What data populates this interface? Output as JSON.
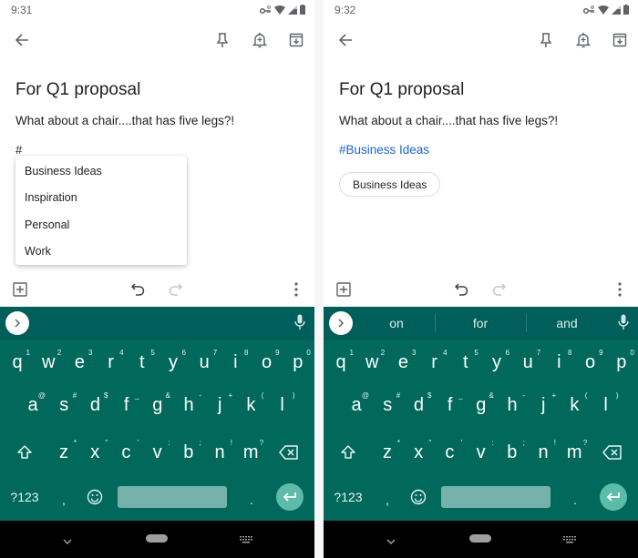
{
  "colors": {
    "keyboard_bg": "#00695c",
    "suggest_bg": "#005e5b",
    "hashtag_link": "#1a66c9",
    "enter_key": "#5dbbaa",
    "spacebar": "#76b2a9"
  },
  "left": {
    "status": {
      "time": "9:31",
      "icons": [
        "vpn-key-icon",
        "wifi-icon",
        "signal-icon",
        "battery-icon"
      ]
    },
    "app_bar": {
      "icons": [
        "back-arrow-icon",
        "pin-icon",
        "reminder-bell-icon",
        "archive-icon"
      ]
    },
    "note": {
      "title": "For Q1 proposal",
      "body": "What about a chair....that has five legs?!",
      "typed_text": "#"
    },
    "label_popup": {
      "items": [
        {
          "label": "Business Ideas"
        },
        {
          "label": "Inspiration"
        },
        {
          "label": "Personal"
        },
        {
          "label": "Work"
        }
      ]
    },
    "keyboard": {
      "suggestions": []
    }
  },
  "right": {
    "status": {
      "time": "9:32",
      "icons": [
        "vpn-key-icon",
        "wifi-icon",
        "signal-icon",
        "battery-icon"
      ]
    },
    "app_bar": {
      "icons": [
        "back-arrow-icon",
        "pin-icon",
        "reminder-bell-icon",
        "archive-icon"
      ]
    },
    "note": {
      "title": "For Q1 proposal",
      "body": "What about a chair....that has five legs?!",
      "hashtag": "#Business Ideas",
      "label_chip": "Business Ideas"
    },
    "keyboard": {
      "suggestions": [
        "on",
        "for",
        "and"
      ]
    }
  },
  "keyboard_layout": {
    "row1": [
      {
        "key": "q",
        "hint": "1"
      },
      {
        "key": "w",
        "hint": "2"
      },
      {
        "key": "e",
        "hint": "3"
      },
      {
        "key": "r",
        "hint": "4"
      },
      {
        "key": "t",
        "hint": "5"
      },
      {
        "key": "y",
        "hint": "6"
      },
      {
        "key": "u",
        "hint": "7"
      },
      {
        "key": "i",
        "hint": "8"
      },
      {
        "key": "o",
        "hint": "9"
      },
      {
        "key": "p",
        "hint": "0"
      }
    ],
    "row2": [
      {
        "key": "a",
        "hint": "@"
      },
      {
        "key": "s",
        "hint": "#"
      },
      {
        "key": "d",
        "hint": "$"
      },
      {
        "key": "f",
        "hint": "_"
      },
      {
        "key": "g",
        "hint": "&"
      },
      {
        "key": "h",
        "hint": "-"
      },
      {
        "key": "j",
        "hint": "+"
      },
      {
        "key": "k",
        "hint": "("
      },
      {
        "key": "l",
        "hint": ")"
      }
    ],
    "row3": [
      {
        "key": "z",
        "hint": "*"
      },
      {
        "key": "x",
        "hint": "\""
      },
      {
        "key": "c",
        "hint": "'"
      },
      {
        "key": "v",
        "hint": ":"
      },
      {
        "key": "b",
        "hint": ";"
      },
      {
        "key": "n",
        "hint": "!"
      },
      {
        "key": "m",
        "hint": "?"
      }
    ],
    "symbols_key": "?123",
    "comma_key": ",",
    "period_key": ".",
    "special_icons": [
      "shift-icon",
      "backspace-icon",
      "emoji-icon",
      "enter-icon",
      "mic-icon",
      "expand-toolbar-icon"
    ]
  },
  "nav_bar": {
    "icons": [
      "hide-keyboard-icon",
      "home-pill-icon",
      "keyboard-switch-icon"
    ]
  }
}
